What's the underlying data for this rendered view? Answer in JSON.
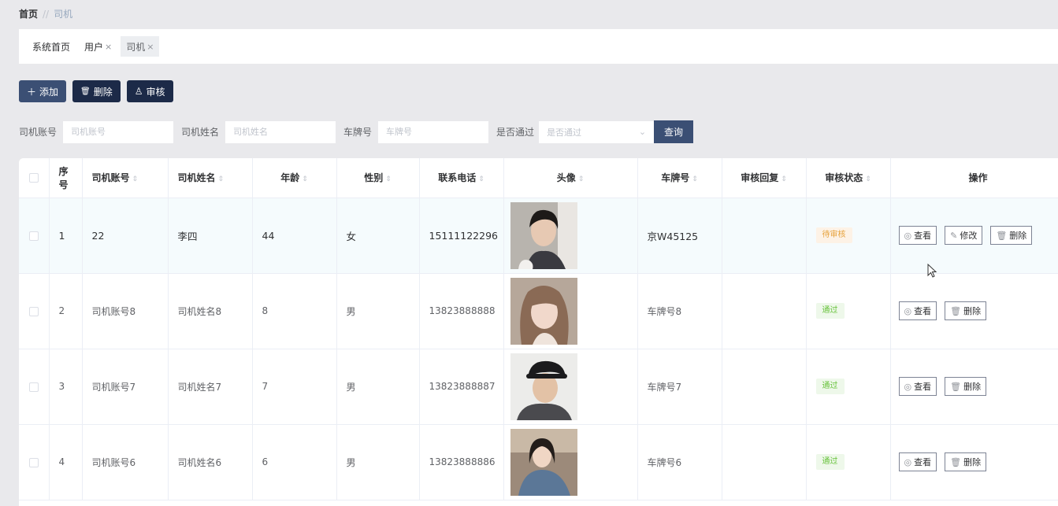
{
  "breadcrumb": {
    "home": "首页",
    "separator": "//",
    "current": "司机"
  },
  "tabs": [
    {
      "label": "系统首页",
      "closable": false
    },
    {
      "label": "用户",
      "closable": true
    },
    {
      "label": "司机",
      "closable": true
    }
  ],
  "tab_close": "×",
  "toolbar": {
    "add": {
      "icon": "plus-icon",
      "glyph": "＋",
      "label": "添加"
    },
    "delete": {
      "icon": "trash-icon",
      "glyph": "🗑",
      "label": "删除"
    },
    "audit": {
      "icon": "user-icon",
      "glyph": "♙",
      "label": "审核"
    }
  },
  "search": {
    "account_label": "司机账号",
    "account_placeholder": "司机账号",
    "name_label": "司机姓名",
    "name_placeholder": "司机姓名",
    "plate_label": "车牌号",
    "plate_placeholder": "车牌号",
    "passed_label": "是否通过",
    "passed_placeholder": "是否通过",
    "query_button": "查询"
  },
  "table": {
    "headers": {
      "index": "序号",
      "account": "司机账号",
      "name": "司机姓名",
      "age": "年龄",
      "gender": "性别",
      "phone": "联系电话",
      "avatar": "头像",
      "plate": "车牌号",
      "reply": "审核回复",
      "status": "审核状态",
      "actions": "操作"
    },
    "sort_glyph": "⇕",
    "rows": [
      {
        "index": "1",
        "account": "22",
        "name": "李四",
        "age": "44",
        "gender": "女",
        "phone": "15111122296",
        "plate": "京W45125",
        "reply": "",
        "status": "待审核",
        "status_type": "pending"
      },
      {
        "index": "2",
        "account": "司机账号8",
        "name": "司机姓名8",
        "age": "8",
        "gender": "男",
        "phone": "13823888888",
        "plate": "车牌号8",
        "reply": "",
        "status": "通过",
        "status_type": "pass"
      },
      {
        "index": "3",
        "account": "司机账号7",
        "name": "司机姓名7",
        "age": "7",
        "gender": "男",
        "phone": "13823888887",
        "plate": "车牌号7",
        "reply": "",
        "status": "通过",
        "status_type": "pass"
      },
      {
        "index": "4",
        "account": "司机账号6",
        "name": "司机姓名6",
        "age": "6",
        "gender": "男",
        "phone": "13823888886",
        "plate": "车牌号6",
        "reply": "",
        "status": "通过",
        "status_type": "pass"
      }
    ],
    "actions": {
      "view": "查看",
      "edit": "修改",
      "delete": "删除"
    }
  },
  "colors": {
    "dark_button": "#1c2a48",
    "primary_button": "#3b4f74",
    "pending": "#e6a23c",
    "pass": "#67c23a"
  }
}
